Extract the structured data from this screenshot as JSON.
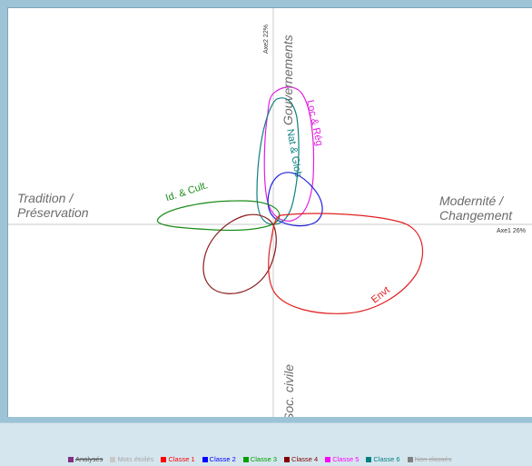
{
  "axes": {
    "left_title_line1": "Tradition /",
    "left_title_line2": "Préservation",
    "right_title_line1": "Modernité /",
    "right_title_line2": "Changement",
    "top_title": "Gouvernements",
    "bottom_title": "Soc. civile",
    "axis1_label": "Axe1",
    "axis1_pct": "26%",
    "axis2_label": "Axe2",
    "axis2_pct": "22%"
  },
  "classes": [
    {
      "label": "Id. & Cult.",
      "color": "#1a8c1a"
    },
    {
      "label": "Nat & Glob",
      "color": "#0f7f7f"
    },
    {
      "label": "Loc & Rég",
      "color": "#e020e0"
    },
    {
      "label": "Envt",
      "color": "#e02020"
    }
  ],
  "legend": [
    {
      "label": "Analysés",
      "color": "#803080",
      "struck": true,
      "muted": false
    },
    {
      "label": "Mots étoilés",
      "color": "#c8c8c8",
      "struck": false,
      "muted": true
    },
    {
      "label": "Classe 1",
      "color": "#ff0000",
      "struck": false,
      "muted": false
    },
    {
      "label": "Classe 2",
      "color": "#0000ff",
      "struck": false,
      "muted": false
    },
    {
      "label": "Classe 3",
      "color": "#00a000",
      "struck": false,
      "muted": false
    },
    {
      "label": "Classe 4",
      "color": "#800000",
      "struck": false,
      "muted": false
    },
    {
      "label": "Classe 5",
      "color": "#ff00ff",
      "struck": false,
      "muted": false
    },
    {
      "label": "Classe 6",
      "color": "#008080",
      "struck": false,
      "muted": false
    },
    {
      "label": "Non classés",
      "color": "#808080",
      "struck": true,
      "muted": true
    }
  ]
}
